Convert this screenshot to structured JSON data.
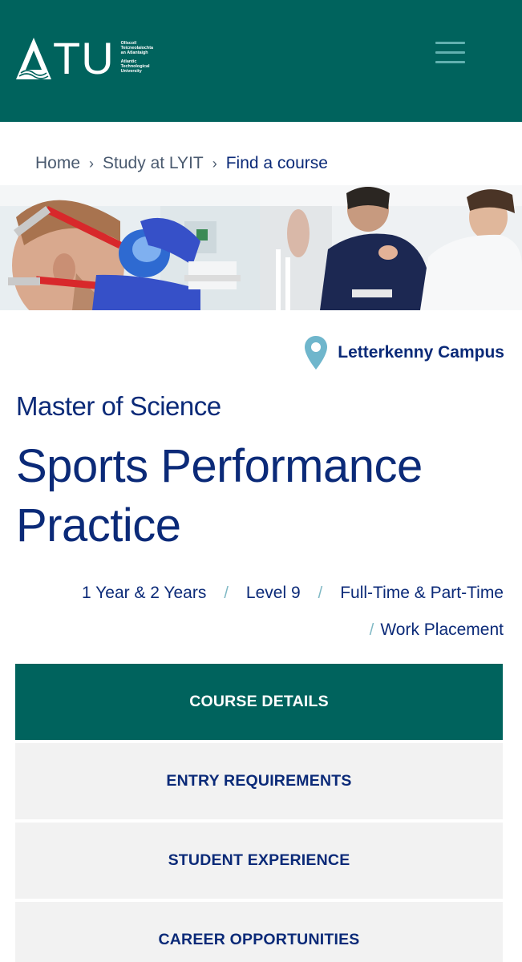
{
  "header": {
    "logo_letters": "TU",
    "logo_text_irish": [
      "Ollscoil",
      "Teicneolaíochta",
      "an Atlantaigh"
    ],
    "logo_text_english": [
      "Atlantic",
      "Technological",
      "University"
    ],
    "menu_icon": "hamburger-menu-icon",
    "background_color": "#00635d"
  },
  "breadcrumb": {
    "items": [
      "Home",
      "Study at LYIT",
      "Find a course"
    ],
    "separator": "›"
  },
  "campus": {
    "icon": "map-pin-icon",
    "name": "Letterkenny Campus"
  },
  "course": {
    "degree": "Master of Science",
    "title": "Sports Performance Practice"
  },
  "facts": {
    "duration": "1 Year & 2 Years",
    "level": "Level 9",
    "mode": "Full-Time & Part-Time",
    "placement": "Work Placement",
    "separator": "/"
  },
  "tabs": [
    {
      "label": "COURSE DETAILS",
      "active": true
    },
    {
      "label": "ENTRY REQUIREMENTS",
      "active": false
    },
    {
      "label": "STUDENT EXPERIENCE",
      "active": false
    },
    {
      "label": "CAREER OPPORTUNITIES",
      "active": false
    }
  ],
  "colors": {
    "brand_teal": "#00635d",
    "text_navy": "#0b2a78",
    "accent_light_teal": "#62b1b0",
    "tab_inactive_bg": "#f2f2f2"
  }
}
